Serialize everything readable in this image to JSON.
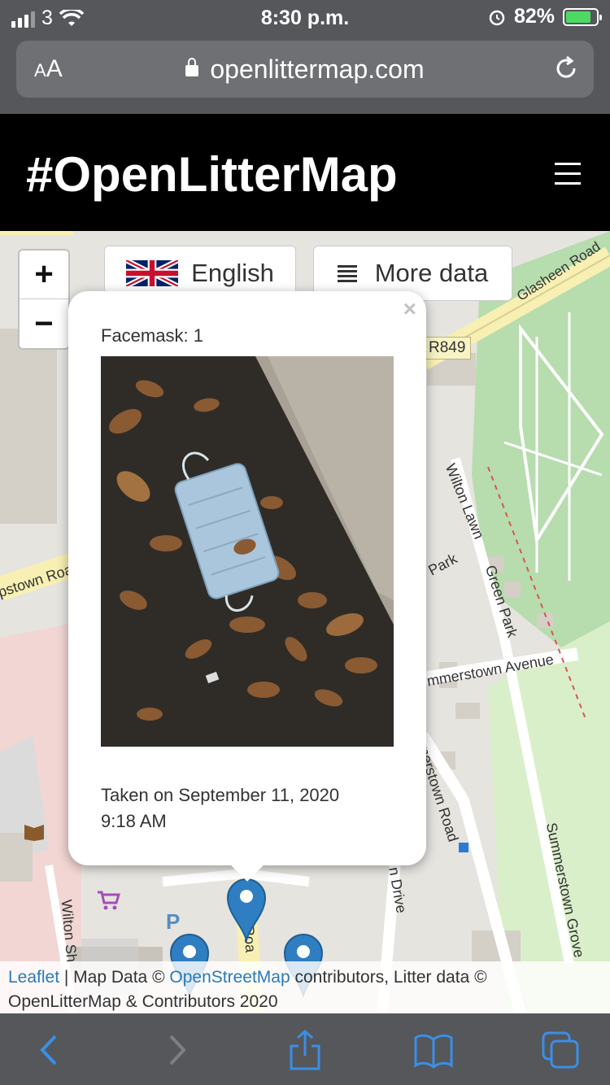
{
  "status_bar": {
    "carrier": "3",
    "time": "8:30 p.m.",
    "battery": "82%",
    "battery_level": 0.82
  },
  "browser": {
    "text_size_label": "AA",
    "url": "openlittermap.com",
    "icons": [
      "lock-icon",
      "reload-icon"
    ]
  },
  "site": {
    "title": "#OpenLitterMap",
    "menu_icon": "hamburger-icon"
  },
  "map": {
    "zoom_in": "+",
    "zoom_out": "−",
    "language_button": "English",
    "more_data_button": "More data",
    "labels": {
      "glasheen_road": "Glasheen Road",
      "r849": "R849",
      "wilton_lawn": "Wilton Lawn",
      "green_park": "Green Park",
      "park": "Park",
      "summerstown_avenue": "mmerstown Avenue",
      "summerstown_road": "merstown Road",
      "summerstown_grove": "Summerstown Grove",
      "drive": "n Drive",
      "wilton_sh": "Wilton Sh",
      "road": "Roa",
      "stown_road": "pstown Roa"
    }
  },
  "popup": {
    "close": "×",
    "heading": "Facemask: 1",
    "date_line1": "Taken on September 11, 2020",
    "date_line2": "9:18 AM"
  },
  "attribution": {
    "leaflet": "Leaflet",
    "sep1": " | Map Data © ",
    "osm": "OpenStreetMap",
    "rest": " contributors, Litter data © OpenLitterMap & Contributors 2020"
  },
  "toolbar": {
    "icons": [
      "back-icon",
      "forward-icon",
      "share-icon",
      "bookmarks-icon",
      "tabs-icon"
    ]
  }
}
